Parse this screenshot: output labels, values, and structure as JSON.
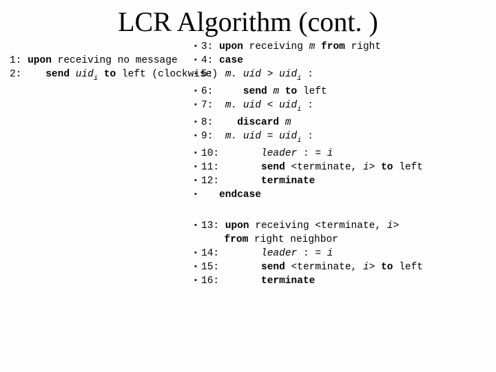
{
  "title": "LCR Algorithm (cont. )",
  "left": {
    "l1_num": "1:",
    "l1_a": "upon",
    "l1_b": "receiving no message",
    "l2_num": "2:",
    "l2_a": "send",
    "l2_uid": "uid",
    "l2_sub": "i",
    "l2_b": "to",
    "l2_c": "left (clockwise)"
  },
  "right": {
    "l3_num": "3:",
    "l3_a": "upon",
    "l3_b": "receiving",
    "l3_m": "m",
    "l3_c": "from",
    "l3_d": "right",
    "l4_num": "4:",
    "l4_a": "case",
    "l5_num": "5:",
    "l5_muid": "m. uid",
    "l5_gt": ">",
    "l5_uid": "uid",
    "l5_sub": "i",
    "l5_colon": ":",
    "l6_num": "6:",
    "l6_a": "send",
    "l6_m": "m",
    "l6_b": "to",
    "l6_c": "left",
    "l7_num": "7:",
    "l7_muid": "m. uid",
    "l7_lt": "<",
    "l7_uid": "uid",
    "l7_sub": "i",
    "l7_colon": ":",
    "l8_num": "8:",
    "l8_a": "discard",
    "l8_m": "m",
    "l9_num": "9:",
    "l9_muid": "m. uid",
    "l9_eq": "=",
    "l9_uid": "uid",
    "l9_sub": "i",
    "l9_colon": ":",
    "l10_num": "10:",
    "l10_a": "leader",
    "l10_b": ": =",
    "l10_i": "i",
    "l11_num": "11:",
    "l11_a": "send",
    "l11_b": "<terminate,",
    "l11_i": "i",
    "l11_c": ">",
    "l11_d": "to",
    "l11_e": "left",
    "l12_num": "12:",
    "l12_a": "terminate",
    "lend_a": "endcase"
  },
  "bottom": {
    "l13_num": "13:",
    "l13_a": "upon",
    "l13_b": "receiving <terminate,",
    "l13_i": "i",
    "l13_c": ">",
    "l13_d": "from",
    "l13_e": "right neighbor",
    "l14_num": "14:",
    "l14_a": "leader",
    "l14_b": ": =",
    "l14_i": "i",
    "l15_num": "15:",
    "l15_a": "send",
    "l15_b": "<terminate,",
    "l15_i": "i",
    "l15_c": ">",
    "l15_d": "to",
    "l15_e": "left",
    "l16_num": "16:",
    "l16_a": "terminate"
  }
}
